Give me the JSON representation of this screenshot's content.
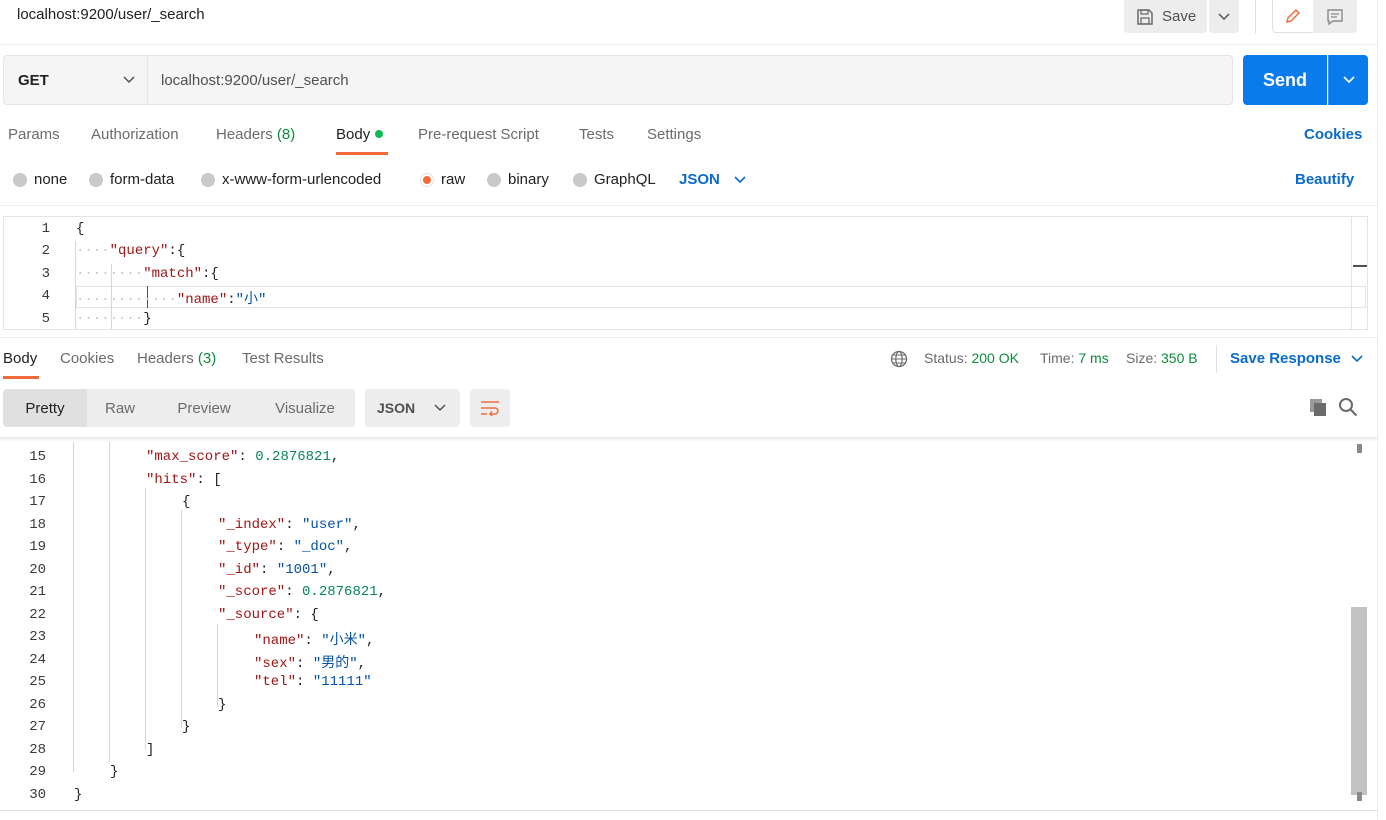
{
  "window": {
    "title": "localhost:9200/user/_search",
    "save_label": "Save"
  },
  "request": {
    "method": "GET",
    "url": "localhost:9200/user/_search",
    "send_label": "Send",
    "tabs": [
      {
        "label": "Params"
      },
      {
        "label": "Authorization"
      },
      {
        "label": "Headers",
        "count": "(8)"
      },
      {
        "label": "Body"
      },
      {
        "label": "Pre-request Script"
      },
      {
        "label": "Tests"
      },
      {
        "label": "Settings"
      }
    ],
    "cookies_label": "Cookies",
    "body_types": [
      "none",
      "form-data",
      "x-www-form-urlencoded",
      "raw",
      "binary",
      "GraphQL"
    ],
    "selected_body_type": "raw",
    "raw_format": "JSON",
    "beautify_label": "Beautify",
    "editor_lines": [
      {
        "num": "1",
        "text": "{"
      },
      {
        "num": "2",
        "text": "\"query\":{"
      },
      {
        "num": "3",
        "text": "\"match\":{"
      },
      {
        "num": "4",
        "text": "\"name\":\"小\""
      },
      {
        "num": "5",
        "text": "}"
      }
    ]
  },
  "response": {
    "tabs": [
      {
        "label": "Body"
      },
      {
        "label": "Cookies"
      },
      {
        "label": "Headers",
        "count": "(3)"
      },
      {
        "label": "Test Results"
      }
    ],
    "status_label": "Status:",
    "status_value": "200 OK",
    "time_label": "Time:",
    "time_value": "7 ms",
    "size_label": "Size:",
    "size_value": "350 B",
    "save_response_label": "Save Response",
    "view_modes": [
      "Pretty",
      "Raw",
      "Preview",
      "Visualize"
    ],
    "format": "JSON",
    "colors": {
      "accent": "#f26b3a",
      "link": "#0b6bcb",
      "send": "#097bed",
      "ok": "#0c8c3c"
    },
    "lines": [
      {
        "num": "15",
        "text": "\"max_score\": 0.2876821,"
      },
      {
        "num": "16",
        "text": "\"hits\": ["
      },
      {
        "num": "17",
        "text": "{"
      },
      {
        "num": "18",
        "text": "\"_index\": \"user\","
      },
      {
        "num": "19",
        "text": "\"_type\": \"_doc\","
      },
      {
        "num": "20",
        "text": "\"_id\": \"1001\","
      },
      {
        "num": "21",
        "text": "\"_score\": 0.2876821,"
      },
      {
        "num": "22",
        "text": "\"_source\": {"
      },
      {
        "num": "23",
        "text": "\"name\": \"小米\","
      },
      {
        "num": "24",
        "text": "\"sex\": \"男的\","
      },
      {
        "num": "25",
        "text": "\"tel\": \"11111\""
      },
      {
        "num": "26",
        "text": "}"
      },
      {
        "num": "27",
        "text": "}"
      },
      {
        "num": "28",
        "text": "]"
      },
      {
        "num": "29",
        "text": "}"
      },
      {
        "num": "30",
        "text": "}"
      }
    ]
  }
}
